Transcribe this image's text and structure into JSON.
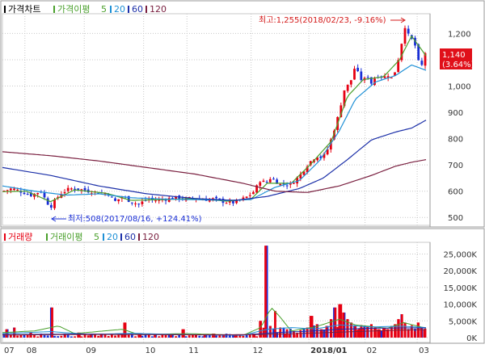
{
  "price_panel": {
    "legend": {
      "title": "가격차트",
      "ma_label": "가격이평",
      "ma_periods": [
        "5",
        "20",
        "60",
        "120"
      ]
    },
    "high_note": "최고:1,255(2018/02/23, -9.16%)",
    "low_note": "최저:508(2017/08/16, +124.41%)",
    "current_value": "1,140",
    "current_change": "(3.64%)"
  },
  "volume_panel": {
    "legend": {
      "title": "거래량",
      "ma_label": "거래이평",
      "ma_periods": [
        "5",
        "20",
        "60",
        "120"
      ]
    }
  },
  "x_axis": {
    "labels": [
      "07",
      "08",
      "09",
      "10",
      "11",
      "12",
      "2018/01",
      "02",
      "03"
    ]
  },
  "colors": {
    "candle_up": "#e60012",
    "candle_down": "#1a2fd6",
    "ma5": "#4aa02c",
    "ma20": "#1e90d6",
    "ma60": "#1b2fa8",
    "ma120": "#7a2040",
    "grid": "#c8c8c8",
    "note": "#d41a1a",
    "current_box": "#e0101a"
  },
  "chart_data": [
    {
      "type": "candlestick",
      "title": "가격차트",
      "y_ticks": [
        "500",
        "600",
        "700",
        "800",
        "900",
        "1,000",
        "1,100",
        "1,200"
      ],
      "ylim": [
        470,
        1275
      ],
      "grid": true,
      "series_legend": [
        "5",
        "20",
        "60",
        "120"
      ],
      "current": 1140,
      "high": {
        "value": 1255,
        "date": "2018/02/23",
        "pct": "-9.16%"
      },
      "low": {
        "value": 508,
        "date": "2017/08/16",
        "pct": "+124.41%"
      },
      "close_path": [
        [
          0,
          600
        ],
        [
          12,
          610
        ],
        [
          24,
          598
        ],
        [
          36,
          585
        ],
        [
          48,
          600
        ],
        [
          55,
          560
        ],
        [
          60,
          540
        ],
        [
          64,
          558
        ],
        [
          72,
          590
        ],
        [
          84,
          610
        ],
        [
          96,
          608
        ],
        [
          108,
          600
        ],
        [
          120,
          595
        ],
        [
          132,
          590
        ],
        [
          140,
          560
        ],
        [
          150,
          580
        ],
        [
          160,
          560
        ],
        [
          170,
          550
        ],
        [
          180,
          570
        ],
        [
          192,
          565
        ],
        [
          204,
          570
        ],
        [
          216,
          575
        ],
        [
          228,
          570
        ],
        [
          240,
          575
        ],
        [
          252,
          568
        ],
        [
          264,
          570
        ],
        [
          276,
          560
        ],
        [
          286,
          555
        ],
        [
          296,
          565
        ],
        [
          306,
          580
        ],
        [
          314,
          600
        ],
        [
          322,
          645
        ],
        [
          328,
          628
        ],
        [
          334,
          650
        ],
        [
          340,
          640
        ],
        [
          346,
          625
        ],
        [
          352,
          630
        ],
        [
          358,
          622
        ],
        [
          364,
          640
        ],
        [
          372,
          665
        ],
        [
          380,
          700
        ],
        [
          386,
          720
        ],
        [
          392,
          735
        ],
        [
          398,
          725
        ],
        [
          404,
          750
        ],
        [
          410,
          800
        ],
        [
          415,
          850
        ],
        [
          420,
          900
        ],
        [
          425,
          980
        ],
        [
          430,
          1000
        ],
        [
          435,
          1025
        ],
        [
          440,
          1080
        ],
        [
          445,
          1030
        ],
        [
          450,
          1020
        ],
        [
          455,
          1040
        ],
        [
          460,
          1010
        ],
        [
          465,
          1035
        ],
        [
          470,
          1040
        ],
        [
          475,
          1030
        ],
        [
          480,
          1045
        ],
        [
          485,
          1030
        ],
        [
          490,
          1060
        ],
        [
          494,
          1110
        ],
        [
          498,
          1170
        ],
        [
          502,
          1230
        ],
        [
          505,
          1200
        ],
        [
          508,
          1180
        ],
        [
          512,
          1175
        ],
        [
          516,
          1140
        ],
        [
          519,
          1085
        ],
        [
          522,
          1070
        ],
        [
          525,
          1100
        ],
        [
          528,
          1140
        ]
      ],
      "ma_paths": {
        "5": [
          [
            0,
            598
          ],
          [
            30,
            600
          ],
          [
            60,
            560
          ],
          [
            90,
            605
          ],
          [
            130,
            592
          ],
          [
            160,
            565
          ],
          [
            200,
            568
          ],
          [
            240,
            572
          ],
          [
            280,
            562
          ],
          [
            310,
            570
          ],
          [
            330,
            630
          ],
          [
            360,
            630
          ],
          [
            385,
            705
          ],
          [
            410,
            790
          ],
          [
            430,
            960
          ],
          [
            450,
            1025
          ],
          [
            475,
            1035
          ],
          [
            495,
            1100
          ],
          [
            510,
            1190
          ],
          [
            528,
            1115
          ]
        ],
        "20": [
          [
            0,
            620
          ],
          [
            40,
            600
          ],
          [
            80,
            585
          ],
          [
            120,
            590
          ],
          [
            160,
            575
          ],
          [
            200,
            570
          ],
          [
            240,
            568
          ],
          [
            280,
            565
          ],
          [
            310,
            568
          ],
          [
            340,
            615
          ],
          [
            370,
            640
          ],
          [
            395,
            715
          ],
          [
            420,
            830
          ],
          [
            440,
            950
          ],
          [
            465,
            1015
          ],
          [
            490,
            1040
          ],
          [
            510,
            1080
          ],
          [
            528,
            1060
          ]
        ],
        "60": [
          [
            0,
            690
          ],
          [
            60,
            660
          ],
          [
            120,
            620
          ],
          [
            180,
            590
          ],
          [
            240,
            572
          ],
          [
            290,
            565
          ],
          [
            330,
            580
          ],
          [
            370,
            610
          ],
          [
            400,
            650
          ],
          [
            430,
            720
          ],
          [
            460,
            795
          ],
          [
            490,
            825
          ],
          [
            510,
            840
          ],
          [
            528,
            870
          ]
        ],
        "120": [
          [
            0,
            750
          ],
          [
            60,
            735
          ],
          [
            120,
            715
          ],
          [
            180,
            690
          ],
          [
            240,
            665
          ],
          [
            300,
            630
          ],
          [
            340,
            600
          ],
          [
            380,
            595
          ],
          [
            420,
            620
          ],
          [
            460,
            660
          ],
          [
            490,
            695
          ],
          [
            510,
            710
          ],
          [
            528,
            720
          ]
        ]
      }
    },
    {
      "type": "bar",
      "title": "거래량",
      "y_ticks": [
        "0K",
        "5,000K",
        "10,000K",
        "15,000K",
        "20,000K",
        "25,000K"
      ],
      "ylim": [
        0,
        28500
      ],
      "grid": true,
      "series_legend": [
        "5",
        "20",
        "60",
        "120"
      ],
      "spikes": [
        [
          5,
          2500
        ],
        [
          15,
          3000
        ],
        [
          35,
          1500
        ],
        [
          48,
          1000
        ],
        [
          62,
          9000
        ],
        [
          78,
          1200
        ],
        [
          96,
          1500
        ],
        [
          110,
          800
        ],
        [
          123,
          1000
        ],
        [
          152,
          4500
        ],
        [
          172,
          1200
        ],
        [
          190,
          900
        ],
        [
          210,
          700
        ],
        [
          226,
          2500
        ],
        [
          241,
          900
        ],
        [
          252,
          800
        ],
        [
          264,
          1200
        ],
        [
          276,
          700
        ],
        [
          290,
          600
        ],
        [
          300,
          500
        ],
        [
          314,
          1200
        ],
        [
          322,
          5000
        ],
        [
          328,
          27500
        ],
        [
          334,
          3500
        ],
        [
          340,
          8000
        ],
        [
          346,
          1800
        ],
        [
          352,
          1200
        ],
        [
          358,
          1000
        ],
        [
          364,
          900
        ],
        [
          372,
          1300
        ],
        [
          380,
          3000
        ],
        [
          386,
          6500
        ],
        [
          392,
          4000
        ],
        [
          398,
          2500
        ],
        [
          404,
          3500
        ],
        [
          410,
          5500
        ],
        [
          415,
          9000
        ],
        [
          420,
          10000
        ],
        [
          425,
          7500
        ],
        [
          430,
          5500
        ],
        [
          435,
          4500
        ],
        [
          440,
          3500
        ],
        [
          445,
          2800
        ],
        [
          450,
          3000
        ],
        [
          455,
          3200
        ],
        [
          460,
          4000
        ],
        [
          465,
          3000
        ],
        [
          470,
          2500
        ],
        [
          475,
          3000
        ],
        [
          480,
          2500
        ],
        [
          485,
          3500
        ],
        [
          490,
          4000
        ],
        [
          494,
          5500
        ],
        [
          498,
          7000
        ],
        [
          502,
          4500
        ],
        [
          506,
          2500
        ],
        [
          510,
          3000
        ],
        [
          514,
          2000
        ],
        [
          518,
          4500
        ],
        [
          522,
          3000
        ],
        [
          526,
          2500
        ]
      ]
    }
  ]
}
